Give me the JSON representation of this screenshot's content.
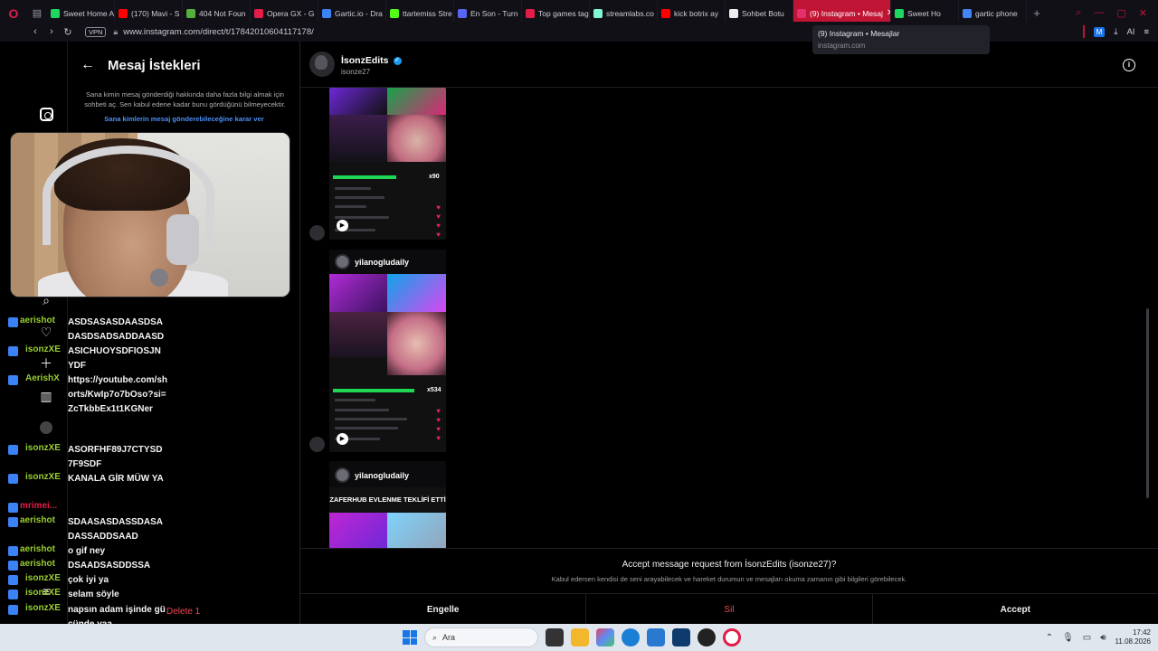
{
  "browser": {
    "tabs": [
      {
        "label": "Sweet Home A",
        "color": "#1ed760"
      },
      {
        "label": "(170) Mavi - S",
        "color": "#ff0000"
      },
      {
        "label": "404 Not Foun",
        "color": "#53b13b"
      },
      {
        "label": "Opera GX - G",
        "color": "#e11d48"
      },
      {
        "label": "Gartic.io - Dra",
        "color": "#3b82f6"
      },
      {
        "label": "ttartemiss Stre",
        "color": "#53fc18"
      },
      {
        "label": "En Son - Turn",
        "color": "#5865f2"
      },
      {
        "label": "Top games tag",
        "color": "#e11d48"
      },
      {
        "label": "streamlabs.co",
        "color": "#80f5d2"
      },
      {
        "label": "kick botrix ay",
        "color": "#ff0000"
      },
      {
        "label": "Sohbet Botu",
        "color": "#eeeeee"
      },
      {
        "label": "(9) Instagram • Mesaj",
        "color": "#e1306c",
        "active": true
      },
      {
        "label": "Sweet Ho",
        "color": "#1ed760"
      },
      {
        "label": "gartic phone",
        "color": "#4285f4"
      }
    ],
    "vpn_label": "VPN",
    "url": "www.instagram.com/direct/t/17842010604117178/",
    "ext_label": "M",
    "ai_label": "AI",
    "tooltip": {
      "title": "(9) Instagram • Mesajlar",
      "domain": "instagram.com"
    }
  },
  "requests": {
    "title": "Mesaj İstekleri",
    "description": "Sana kimin mesaj gönderdiği hakkında daha fazla bilgi almak için sohbeti aç. Sen kabul edene kadar bunu gördüğünü bilmeyecektir.",
    "link": "Sana kimlerin mesaj gönderebileceğine karar ver"
  },
  "chat": {
    "name": "İsonzEdits",
    "username": "isonze27",
    "reels": [
      {
        "author": "",
        "counter": "x90"
      },
      {
        "author": "yilanogludaily",
        "counter": "x534"
      },
      {
        "author": "yilanogludaily",
        "caption": "ZAFERHUB EVLENME TEKLİFİ ETTİ"
      }
    ],
    "accept": {
      "title": "Accept message request from İsonzEdits (isonze27)?",
      "subtitle": "Kabul edersen kendisi de seni arayabilecek ve hareket durumun ve mesajları okuma zamanın gibi bilgileri görebilecek.",
      "block_label": "Engelle",
      "delete_label": "Sil",
      "accept_label": "Accept"
    }
  },
  "stream_chat": [
    {
      "name": "aerishot",
      "color": "#9acd32",
      "msg": "ASDSASASDAASDSA DASDSADSADDAASD"
    },
    {
      "name": "isonzXE",
      "color": "#9acd32",
      "msg": "ASICHUOYSDFIOSJN YDF"
    },
    {
      "name": "AerishX",
      "color": "#9acd32",
      "msg": "https://youtube.com/shorts/KwIp7o7bOso?si=ZcTkbbEx1t1KGNer"
    },
    {
      "name": "isonzXE",
      "color": "#9acd32",
      "msg": "ASORFHF89J7CTYSD7F9SDF"
    },
    {
      "name": "isonzXE",
      "color": "#9acd32",
      "msg": "KANALA GİR MÜW YA"
    },
    {
      "name": "mrimei...",
      "color": "#e11d48",
      "msg": ""
    },
    {
      "name": "aerishot",
      "color": "#9acd32",
      "msg": "SDAASASDASSDASA DASSADDSAAD"
    },
    {
      "name": "aerishot",
      "color": "#9acd32",
      "msg": "o gif ney"
    },
    {
      "name": "aerishot",
      "color": "#9acd32",
      "msg": "DSAADSASDDSSA"
    },
    {
      "name": "isonzXE",
      "color": "#9acd32",
      "msg": "çok iyi ya"
    },
    {
      "name": "isonzXE",
      "color": "#9acd32",
      "msg": "selam söyle"
    },
    {
      "name": "isonzXE",
      "color": "#9acd32",
      "msg": "napsın adam işinde gücünde yaa"
    }
  ],
  "stream_extra": {
    "delete_label": "Delete 1",
    "faded_name": "aerishot"
  },
  "taskbar": {
    "search_label": "Ara",
    "time": "17:42",
    "date": "11.08.2026"
  }
}
